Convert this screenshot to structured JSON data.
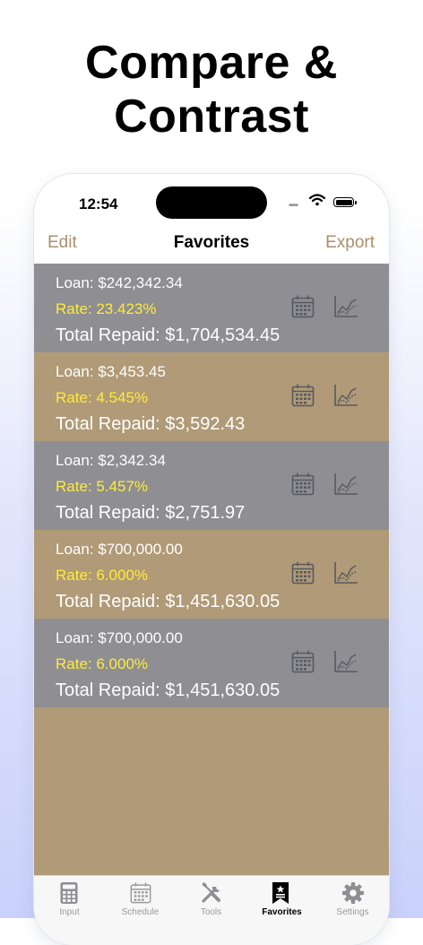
{
  "headline": {
    "line1": "Compare &",
    "line2": "Contrast"
  },
  "status_bar": {
    "time": "12:54",
    "signal": "••••"
  },
  "navbar": {
    "edit": "Edit",
    "title": "Favorites",
    "export": "Export"
  },
  "favorites": [
    {
      "loan": "Loan: $242,342.34",
      "rate": "Rate: 23.423%",
      "total": "Total Repaid: $1,704,534.45"
    },
    {
      "loan": "Loan: $3,453.45",
      "rate": "Rate: 4.545%",
      "total": "Total Repaid: $3,592.43"
    },
    {
      "loan": "Loan: $2,342.34",
      "rate": "Rate: 5.457%",
      "total": "Total Repaid: $2,751.97"
    },
    {
      "loan": "Loan: $700,000.00",
      "rate": "Rate: 6.000%",
      "total": "Total Repaid: $1,451,630.05"
    },
    {
      "loan": "Loan: $700,000.00",
      "rate": "Rate: 6.000%",
      "total": "Total Repaid: $1,451,630.05"
    }
  ],
  "row_icons": {
    "schedule": "calendar-icon",
    "chart": "line-chart-icon"
  },
  "tabs": [
    {
      "label": "Input",
      "icon": "calculator-icon"
    },
    {
      "label": "Schedule",
      "icon": "calendar-icon"
    },
    {
      "label": "Tools",
      "icon": "tools-icon"
    },
    {
      "label": "Favorites",
      "icon": "bookmark-star-icon",
      "active": true
    },
    {
      "label": "Settings",
      "icon": "gear-icon"
    }
  ],
  "colors": {
    "accent": "#a88f6a",
    "row_gray": "#8e8e93",
    "row_tan": "#b09a77",
    "rate_yellow": "#ffeb3b",
    "icon_stroke": "#58595e"
  }
}
